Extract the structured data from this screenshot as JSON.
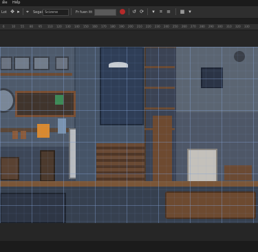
{
  "menubar": {
    "items": [
      "ẩle",
      "Hiểp"
    ]
  },
  "optionsbar": {
    "label_fill": "Lot",
    "label_layer": "Segai",
    "field_value": "Scizene",
    "label_transform": "Fr fuen itt",
    "icons": [
      "move-icon",
      "play-icon",
      "transform-icon",
      "rotate-icon",
      "refresh-icon",
      "dropdown-icon",
      "crop-icon",
      "align-icon",
      "grid-icon"
    ]
  },
  "ruler": {
    "ticks": [
      "6",
      "10",
      "55",
      "80",
      "95",
      "110",
      "120",
      "130",
      "140",
      "150",
      "160",
      "170",
      "180",
      "190",
      "200",
      "210",
      "220",
      "230",
      "240",
      "250",
      "260",
      "270",
      "280",
      "290",
      "300",
      "310",
      "320",
      "330"
    ]
  },
  "canvas": {
    "description_colors": {
      "wall": "#4a5566",
      "floor": "#3d4a5c",
      "wood": "#7a4a2e",
      "accent_blue": "#5a7fb0",
      "grid_line": "#82a0d2"
    }
  }
}
